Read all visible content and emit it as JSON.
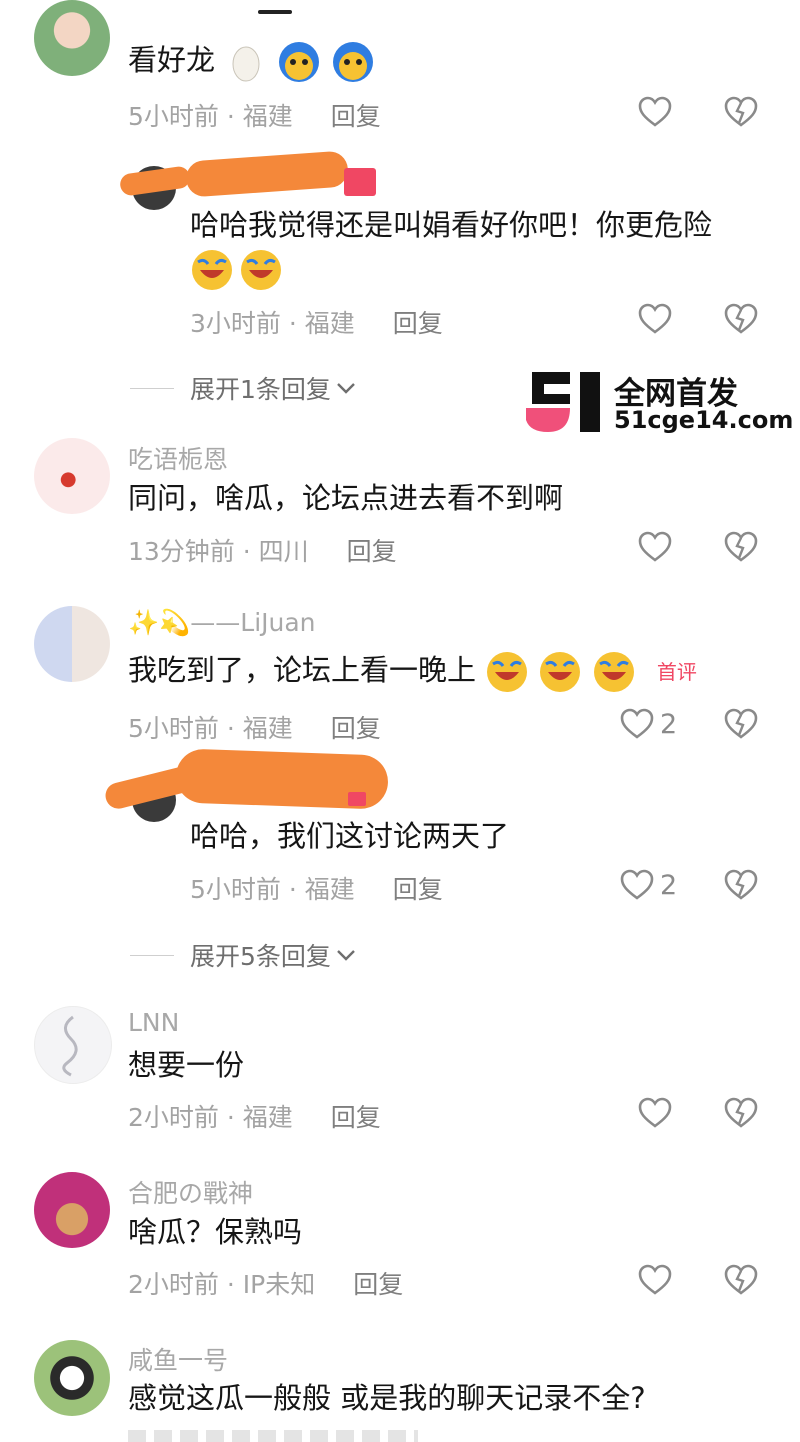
{
  "comments": [
    {
      "id": "c1",
      "username": "",
      "text": "看好龙",
      "time": "5小时前",
      "location": "福建",
      "reply": "回复",
      "likes": ""
    },
    {
      "id": "r1",
      "username": "",
      "text_line1": "哈哈我觉得还是叫娟看好你吧！你更危险",
      "text": "",
      "time": "3小时前",
      "location": "福建",
      "reply": "回复",
      "likes": ""
    },
    {
      "id": "c2",
      "username": "吃语栀恩",
      "text": "同问，啥瓜，论坛点进去看不到啊",
      "time": "13分钟前",
      "location": "四川",
      "reply": "回复",
      "likes": ""
    },
    {
      "id": "c3",
      "username": "——LiJuan",
      "text": "我吃到了，论坛上看一晚上",
      "badge": "首评",
      "time": "5小时前",
      "location": "福建",
      "reply": "回复",
      "likes": "2"
    },
    {
      "id": "r2",
      "username": "",
      "text": "哈哈，我们这讨论两天了",
      "time": "5小时前",
      "location": "福建",
      "reply": "回复",
      "likes": "2"
    },
    {
      "id": "c4",
      "username": "LNN",
      "text": "想要一份",
      "time": "2小时前",
      "location": "福建",
      "reply": "回复",
      "likes": ""
    },
    {
      "id": "c5",
      "username": "合肥の戰神",
      "text": "啥瓜？保熟吗",
      "time": "2小时前",
      "location": "IP未知",
      "reply": "回复",
      "likes": ""
    },
    {
      "id": "c6",
      "username": "咸鱼一号",
      "text": "感觉这瓜一般般 或是我的聊天记录不全?",
      "time": "",
      "location": "",
      "reply": "",
      "likes": ""
    }
  ],
  "expand": [
    {
      "label": "展开1条回复"
    },
    {
      "label": "展开5条回复"
    }
  ],
  "watermark": {
    "line1": "全网首发",
    "line2": "51cge14.com",
    "brand_color": "#f0507a"
  },
  "icons": {
    "like": "heart-outline-icon",
    "dislike": "broken-heart-icon",
    "expand": "chevron-down-icon"
  }
}
